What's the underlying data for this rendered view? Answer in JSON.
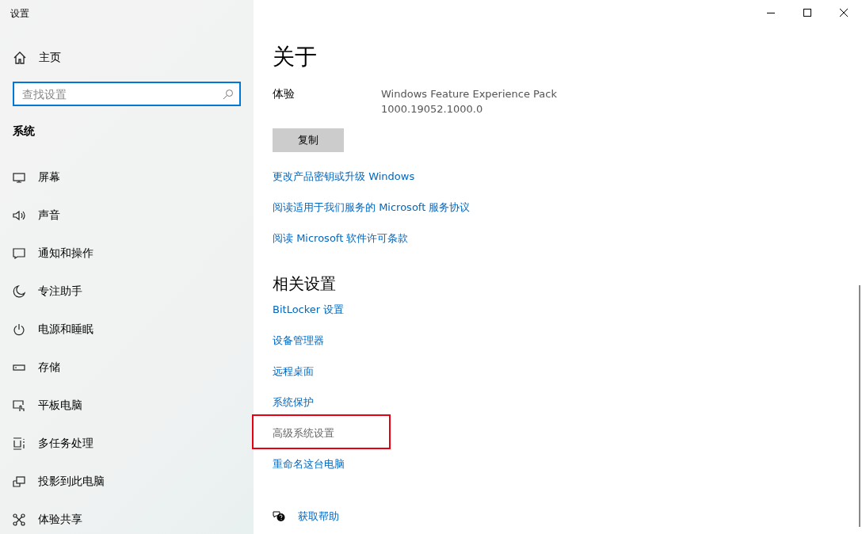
{
  "window": {
    "title": "设置"
  },
  "sidebar": {
    "home": "主页",
    "search": {
      "placeholder": "查找设置"
    },
    "section": "系统",
    "items": [
      {
        "label": "屏幕"
      },
      {
        "label": "声音"
      },
      {
        "label": "通知和操作"
      },
      {
        "label": "专注助手"
      },
      {
        "label": "电源和睡眠"
      },
      {
        "label": "存储"
      },
      {
        "label": "平板电脑"
      },
      {
        "label": "多任务处理"
      },
      {
        "label": "投影到此电脑"
      },
      {
        "label": "体验共享"
      }
    ]
  },
  "main": {
    "title": "关于",
    "specs": [
      {
        "label": "体验",
        "value_lines": [
          "Windows Feature Experience Pack",
          "1000.19052.1000.0"
        ]
      }
    ],
    "copy_button": "复制",
    "links": [
      {
        "label": "更改产品密钥或升级 Windows"
      },
      {
        "label": "阅读适用于我们服务的 Microsoft 服务协议"
      },
      {
        "label": "阅读 Microsoft 软件许可条款"
      }
    ],
    "related": {
      "title": "相关设置",
      "links": [
        {
          "label": "BitLocker 设置",
          "hovered": false,
          "highlighted": false
        },
        {
          "label": "设备管理器",
          "hovered": false,
          "highlighted": false
        },
        {
          "label": "远程桌面",
          "hovered": false,
          "highlighted": false
        },
        {
          "label": "系统保护",
          "hovered": false,
          "highlighted": false
        },
        {
          "label": "高级系统设置",
          "hovered": true,
          "highlighted": true
        },
        {
          "label": "重命名这台电脑",
          "hovered": false,
          "highlighted": false
        }
      ]
    },
    "help": "获取帮助"
  }
}
